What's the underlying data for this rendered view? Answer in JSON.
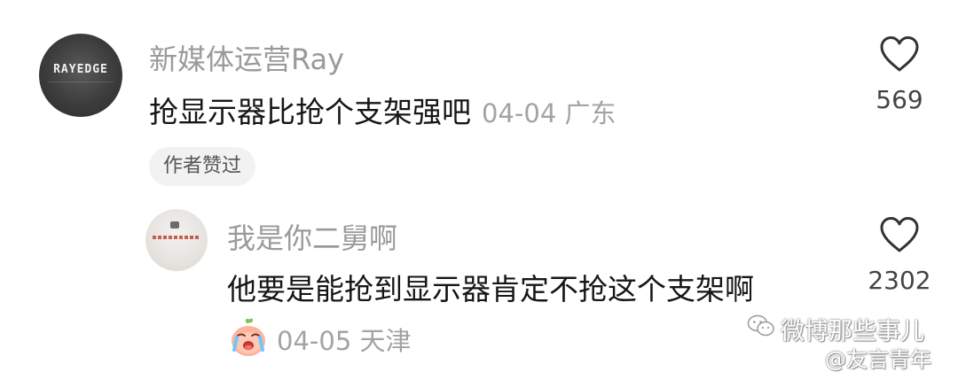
{
  "comment": {
    "avatar_text": "RAYEDGE",
    "username": "新媒体运营Ray",
    "text": "抢显示器比抢个支架强吧",
    "date": "04-04",
    "location": "广东",
    "badge": "作者赞过",
    "likes": "569",
    "like_icon": "heart-outline-icon"
  },
  "reply": {
    "username": "我是你二舅啊",
    "text": "他要是能抢到显示器肯定不抢这个支架啊",
    "emoji": "crying-face-emoji",
    "date_location": "04-05 天津",
    "likes": "2302",
    "like_icon": "heart-outline-icon"
  },
  "watermarks": {
    "wechat": "微博那些事儿",
    "weibo": "@友言青年"
  },
  "colors": {
    "text": "#161616",
    "muted": "#9a9a9a",
    "badge_bg": "#f2f2f2"
  }
}
